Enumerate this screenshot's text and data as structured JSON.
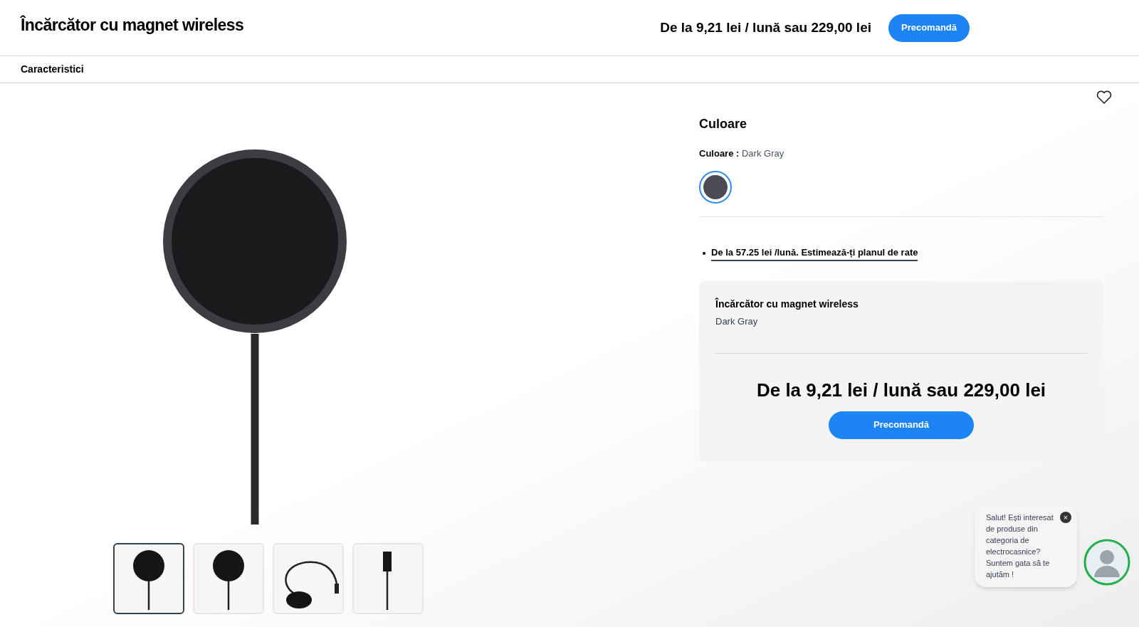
{
  "header": {
    "title": "Încărcător cu magnet wireless",
    "price": "De la 9,21 lei / lună sau 229,00 lei",
    "button": "Precomandă"
  },
  "subnav": {
    "items": [
      {
        "label": "Caracteristici"
      }
    ]
  },
  "gallery": {
    "thumbnails": [
      {
        "kind": "pad",
        "selected": true
      },
      {
        "kind": "pad",
        "selected": false
      },
      {
        "kind": "cable",
        "selected": false
      },
      {
        "kind": "plug",
        "selected": false
      }
    ]
  },
  "options": {
    "heading": "Culoare",
    "color_label": "Culoare :",
    "color_value": "Dark Gray",
    "swatches": [
      {
        "color": "#4a4b55",
        "selected": true
      }
    ],
    "financing_link": "De la 57.25 lei /lună. Estimează-ți planul de rate"
  },
  "summary": {
    "product": "Încărcător cu magnet wireless",
    "variant": "Dark Gray",
    "price": "De la 9,21 lei / lună sau 229,00 lei",
    "button": "Precomandă"
  },
  "chat": {
    "message": "Salut! Ești interesat de produse din categoria de electrocasnice? Suntem gata să te ajutăm !",
    "close": "×"
  }
}
